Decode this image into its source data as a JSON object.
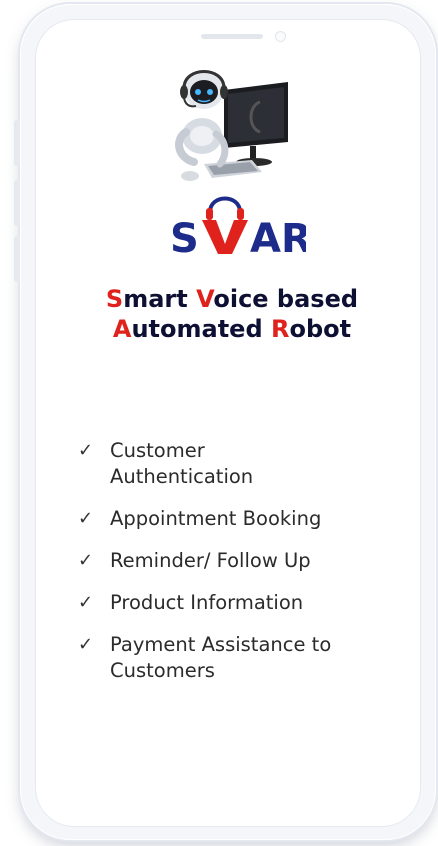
{
  "brand": {
    "logo_text": "SVAR",
    "logo_colors": {
      "s": "#1d2b8a",
      "v": "#e0221c",
      "ar": "#1d2b8a"
    }
  },
  "tagline": {
    "line1": [
      {
        "t": "S",
        "red": true
      },
      {
        "t": "mart ",
        "red": false
      },
      {
        "t": "V",
        "red": true
      },
      {
        "t": "oice based",
        "red": false
      }
    ],
    "line2": [
      {
        "t": "A",
        "red": true
      },
      {
        "t": "utomated ",
        "red": false
      },
      {
        "t": "R",
        "red": true
      },
      {
        "t": "obot",
        "red": false
      }
    ]
  },
  "features": [
    {
      "check": "✓",
      "label": "Customer Authentication"
    },
    {
      "check": "✓",
      "label": "Appointment Booking"
    },
    {
      "check": "✓",
      "label": "Reminder/ Follow Up"
    },
    {
      "check": "✓",
      "label": "Product Information"
    },
    {
      "check": "✓",
      "label": "Payment Assistance to Customers"
    }
  ],
  "icons": {
    "robot": "robot-at-computer-icon",
    "headset": "headset-icon"
  },
  "colors": {
    "accent_red": "#e0221c",
    "brand_blue": "#1d2b8a",
    "text_dark": "#0d0f33"
  }
}
